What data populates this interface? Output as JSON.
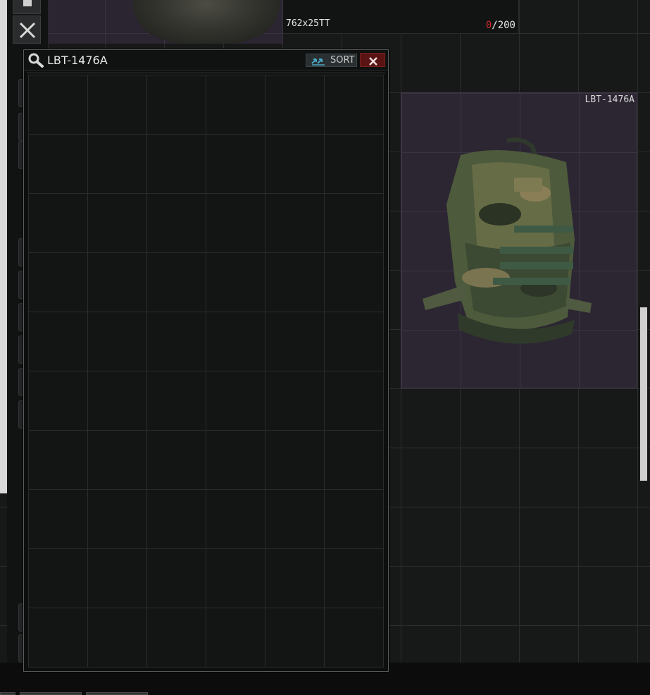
{
  "stash": {
    "ammo_item": {
      "name": "762x25TT",
      "count_current": "0",
      "count_separator": "/",
      "count_max": "200"
    },
    "highlighted_item": {
      "label": "LBT-1476A"
    }
  },
  "search_window": {
    "title": "LBT-1476A",
    "sort_label": "SORT"
  },
  "icons": {
    "toolbar_top": "hammer-icon",
    "toolbar_second": "fork-knife-icon",
    "search": "magnifier-icon",
    "sort": "sort-arrows-icon",
    "close": "close-x-icon"
  },
  "colors": {
    "ammo_zero": "#d22a2a",
    "close_bg": "#5a1313",
    "item_highlight": "#2c2632"
  }
}
